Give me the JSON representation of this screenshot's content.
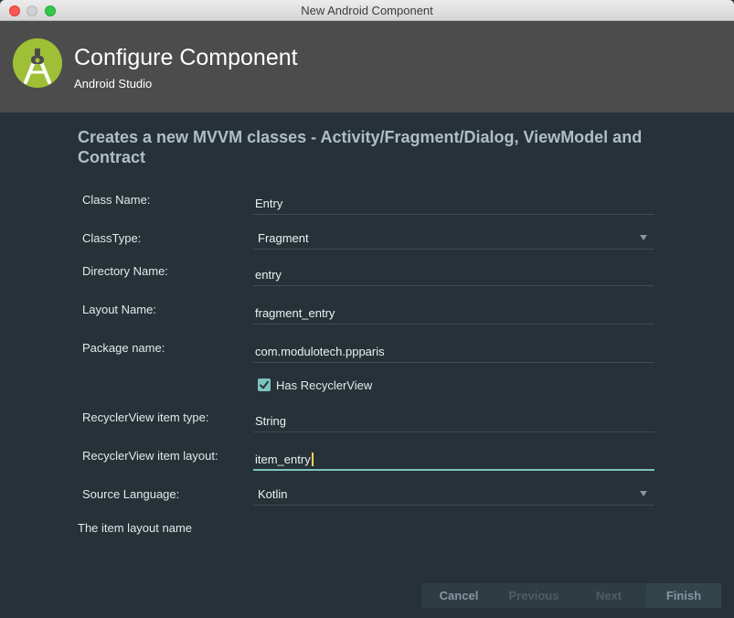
{
  "window": {
    "title": "New Android Component"
  },
  "header": {
    "title": "Configure Component",
    "subtitle": "Android Studio"
  },
  "heading": "Creates a new MVVM classes - Activity/Fragment/Dialog, ViewModel and Contract",
  "form": {
    "class_name": {
      "label": "Class Name:",
      "value": "Entry"
    },
    "class_type": {
      "label": "ClassType:",
      "value": "Fragment"
    },
    "directory_name": {
      "label": "Directory Name:",
      "value": "entry"
    },
    "layout_name": {
      "label": "Layout Name:",
      "value": "fragment_entry"
    },
    "package_name": {
      "label": "Package name:",
      "value": "com.modulotech.ppparis"
    },
    "has_recyclerview": {
      "label": "Has RecyclerView",
      "checked": true
    },
    "recycler_item_type": {
      "label": "RecyclerView item type:",
      "value": "String"
    },
    "recycler_item_layout": {
      "label": "RecyclerView item layout:",
      "value": "item_entry"
    },
    "source_language": {
      "label": "Source Language:",
      "value": "Kotlin"
    }
  },
  "hint": "The item layout name",
  "buttons": {
    "cancel": "Cancel",
    "previous": "Previous",
    "next": "Next",
    "finish": "Finish"
  },
  "colors": {
    "accent": "#7dc4be",
    "header_bg": "#4c4c4c",
    "content_bg": "#263238",
    "android_green": "#a4c639"
  }
}
